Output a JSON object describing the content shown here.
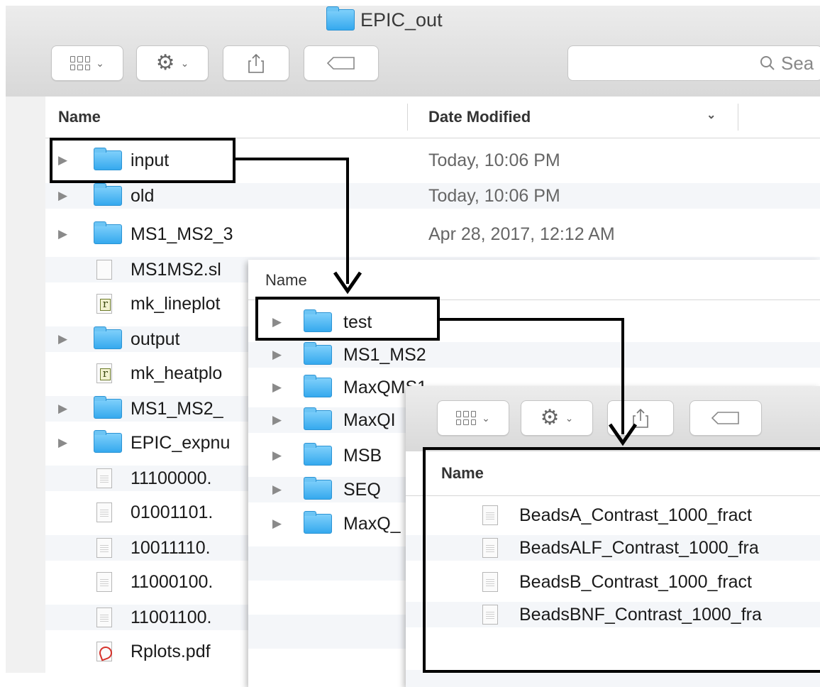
{
  "window_main": {
    "title": "EPIC_out",
    "search_placeholder": "Sea",
    "columns": {
      "name": "Name",
      "date_modified": "Date Modified"
    },
    "rows": [
      {
        "name": "input",
        "type": "folder",
        "date": "Today, 10:06 PM"
      },
      {
        "name": "old",
        "type": "folder",
        "date": "Today, 10:06 PM"
      },
      {
        "name": "MS1_MS2_3",
        "type": "folder",
        "date": "Apr 28, 2017, 12:12 AM"
      },
      {
        "name": "MS1MS2.sl",
        "type": "file",
        "date": ""
      },
      {
        "name": "mk_lineplot",
        "type": "r-script",
        "date": ""
      },
      {
        "name": "output",
        "type": "folder",
        "date": ""
      },
      {
        "name": "mk_heatplo",
        "type": "r-script",
        "date": ""
      },
      {
        "name": "MS1_MS2_",
        "type": "folder",
        "date": ""
      },
      {
        "name": "EPIC_expnu",
        "type": "folder",
        "date": ""
      },
      {
        "name": "11100000.",
        "type": "file",
        "date": ""
      },
      {
        "name": "01001101.",
        "type": "file",
        "date": ""
      },
      {
        "name": "10011110.",
        "type": "file",
        "date": ""
      },
      {
        "name": "11000100.",
        "type": "file",
        "date": ""
      },
      {
        "name": "11001100.",
        "type": "file",
        "date": ""
      },
      {
        "name": "Rplots.pdf",
        "type": "pdf",
        "date": ""
      }
    ]
  },
  "window_input": {
    "column_name": "Name",
    "rows": [
      {
        "name": "test",
        "type": "folder"
      },
      {
        "name": "MS1_MS2",
        "type": "folder"
      },
      {
        "name": "MaxQMS1",
        "type": "folder"
      },
      {
        "name": "MaxQI",
        "type": "folder"
      },
      {
        "name": "MSB",
        "type": "folder"
      },
      {
        "name": "SEQ",
        "type": "folder"
      },
      {
        "name": "MaxQ_",
        "type": "folder"
      }
    ]
  },
  "window_test": {
    "column_name": "Name",
    "rows": [
      {
        "name": "BeadsA_Contrast_1000_fract",
        "type": "file"
      },
      {
        "name": "BeadsALF_Contrast_1000_fra",
        "type": "file"
      },
      {
        "name": "BeadsB_Contrast_1000_fract",
        "type": "file"
      },
      {
        "name": "BeadsBNF_Contrast_1000_fra",
        "type": "file"
      }
    ]
  },
  "colors": {
    "folder_blue": "#35a9ee",
    "selection_border": "#000000",
    "toolbar_gray": "#d8d8d8"
  },
  "icons": [
    "view-options-icon",
    "gear-icon",
    "share-icon",
    "tag-icon",
    "search-icon",
    "folder-icon",
    "document-icon",
    "r-script-icon",
    "pdf-icon",
    "disclosure-triangle-icon"
  ]
}
